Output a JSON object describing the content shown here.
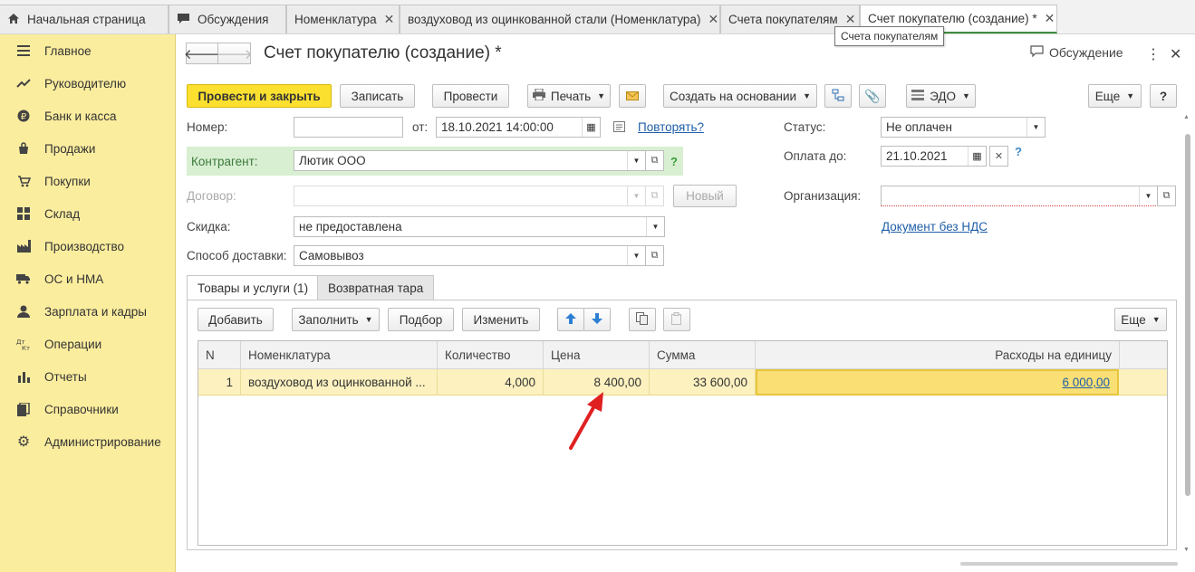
{
  "tabs": [
    {
      "label": "Начальная страница",
      "icon": "home-icon"
    },
    {
      "label": "Обсуждения",
      "icon": "chat-icon"
    },
    {
      "label": "Номенклатура"
    },
    {
      "label": "воздуховод из оцинкованной стали (Номенклатура)"
    },
    {
      "label": "Счета покупателям"
    },
    {
      "label": "Счет покупателю (создание) *"
    }
  ],
  "tooltip": "Счета покупателям",
  "sidebar": {
    "items": [
      {
        "label": "Главное",
        "icon": "menu-lines-icon"
      },
      {
        "label": "Руководителю",
        "icon": "trend-icon"
      },
      {
        "label": "Банк и касса",
        "icon": "ruble-icon"
      },
      {
        "label": "Продажи",
        "icon": "sales-bag-icon"
      },
      {
        "label": "Покупки",
        "icon": "cart-icon"
      },
      {
        "label": "Склад",
        "icon": "warehouse-icon"
      },
      {
        "label": "Производство",
        "icon": "factory-icon"
      },
      {
        "label": "ОС и НМА",
        "icon": "truck-icon"
      },
      {
        "label": "Зарплата и кадры",
        "icon": "person-icon"
      },
      {
        "label": "Операции",
        "icon": "dt-kt-icon"
      },
      {
        "label": "Отчеты",
        "icon": "bar-chart-icon"
      },
      {
        "label": "Справочники",
        "icon": "books-icon"
      },
      {
        "label": "Администрирование",
        "icon": "gear-icon"
      }
    ]
  },
  "header": {
    "title": "Счет покупателю (создание) *",
    "discussion": "Обсуждение"
  },
  "toolbar": {
    "post_close": "Провести и закрыть",
    "save": "Записать",
    "post": "Провести",
    "print": "Печать",
    "create_based": "Создать на основании",
    "edo": "ЭДО",
    "more": "Еще",
    "help": "?"
  },
  "form": {
    "number_label": "Номер:",
    "number_value": "",
    "from_label": "от:",
    "date_value": "18.10.2021 14:00:00",
    "repeat_link": "Повторять?",
    "status_label": "Статус:",
    "status_value": "Не оплачен",
    "pay_until_label": "Оплата до:",
    "pay_until_value": "21.10.2021",
    "contragent_label": "Контрагент:",
    "contragent_value": "Лютик ООО",
    "contract_label": "Договор:",
    "contract_value": "",
    "new_button": "Новый",
    "org_label": "Организация:",
    "org_value": "",
    "discount_label": "Скидка:",
    "discount_value": "не предоставлена",
    "no_vat_link": "Документ без НДС",
    "delivery_label": "Способ доставки:",
    "delivery_value": "Самовывоз",
    "help_q": "?"
  },
  "subtabs": [
    {
      "label": "Товары и услуги (1)"
    },
    {
      "label": "Возвратная тара"
    }
  ],
  "table_toolbar": {
    "add": "Добавить",
    "fill": "Заполнить",
    "select": "Подбор",
    "change": "Изменить",
    "more": "Еще"
  },
  "table": {
    "columns": [
      "N",
      "Номенклатура",
      "Количество",
      "Цена",
      "Сумма",
      "Расходы на единицу"
    ],
    "rows": [
      {
        "n": "1",
        "item": "воздуховод из оцинкованной ...",
        "qty": "4,000",
        "price": "8 400,00",
        "sum": "33 600,00",
        "cost_per_unit": "6 000,00"
      }
    ]
  },
  "colors": {
    "sidebar_bg": "#fbed9e",
    "primary_button": "#fce030",
    "row_highlight": "#fcf1bf",
    "link": "#1f5fa8",
    "arrow": "#e02020"
  }
}
